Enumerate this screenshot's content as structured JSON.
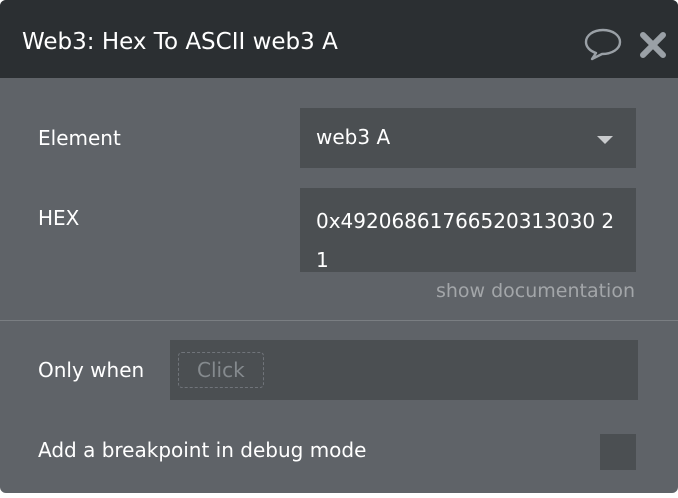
{
  "header": {
    "title": "Web3: Hex To ASCII web3 A",
    "icons": [
      "comment-icon",
      "close-icon"
    ]
  },
  "fields": {
    "element": {
      "label": "Element",
      "value": "web3 A"
    },
    "hex": {
      "label": "HEX",
      "value": "0x49206861766520313030 21"
    }
  },
  "docs_link": "show documentation",
  "only_when": {
    "label": "Only when",
    "placeholder": "Click"
  },
  "breakpoint": {
    "label": "Add a breakpoint in debug mode",
    "checked": false
  },
  "colors": {
    "panel": "#5f6368",
    "header": "#2b2f32",
    "field": "#4b4f52",
    "muted_text": "#a3a6a9"
  }
}
